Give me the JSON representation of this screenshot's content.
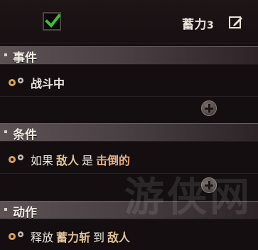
{
  "gambit": {
    "enabled": true,
    "name": "蓄力",
    "number": "3"
  },
  "sections": {
    "event": {
      "title": "事件",
      "text": "战斗中"
    },
    "condition": {
      "title": "条件",
      "prefix": "如果",
      "target": "敌人",
      "verb": "是",
      "state": "击倒的"
    },
    "action": {
      "title": "动作",
      "prefix": "释放",
      "skill": "蓄力斩",
      "verb": "到",
      "target": "敌人"
    }
  },
  "watermark": "游侠网",
  "icons": {
    "checkbox": "check-icon",
    "edit": "edit-icon",
    "gears": "gears-icon",
    "plus": "plus-circle-icon"
  },
  "colors": {
    "check": "#3fbf3a",
    "highlight": "#e2c49a"
  }
}
